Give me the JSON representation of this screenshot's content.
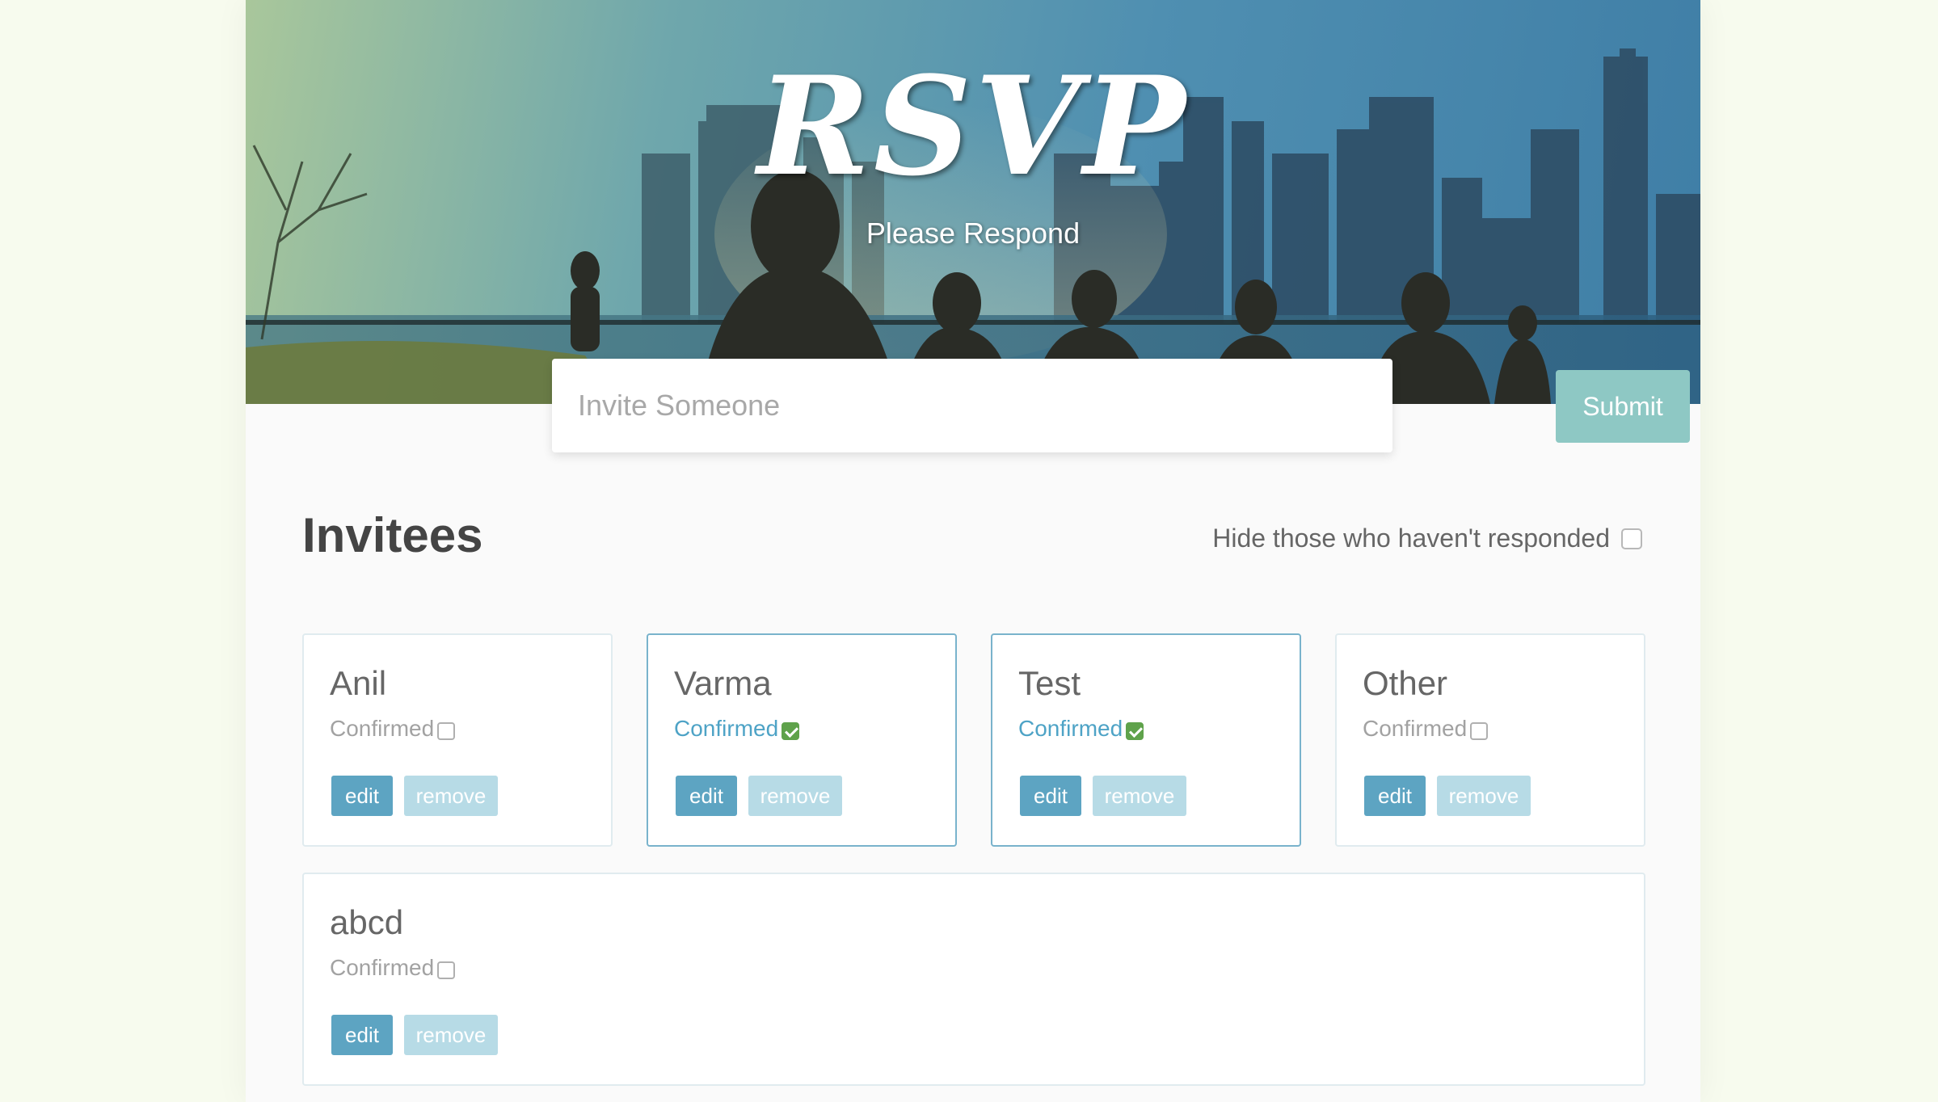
{
  "hero": {
    "title": "RSVP",
    "subtitle": "Please Respond"
  },
  "invite": {
    "placeholder": "Invite Someone",
    "value": "",
    "submit_label": "Submit"
  },
  "invitees": {
    "title": "Invitees",
    "hide_label": "Hide those who haven't responded",
    "hide_checked": false,
    "edit_label": "edit",
    "remove_label": "remove",
    "confirmed_label": "Confirmed",
    "items": [
      {
        "name": "Anil",
        "confirmed": false
      },
      {
        "name": "Varma",
        "confirmed": true
      },
      {
        "name": "Test",
        "confirmed": true
      },
      {
        "name": "Other",
        "confirmed": false
      },
      {
        "name": "abcd",
        "confirmed": false
      }
    ]
  },
  "colors": {
    "accent": "#5da4c2",
    "submit": "#8ec8c4",
    "confirmed_text": "#4ea3c6",
    "checkbox_checked": "#5fa24b"
  }
}
